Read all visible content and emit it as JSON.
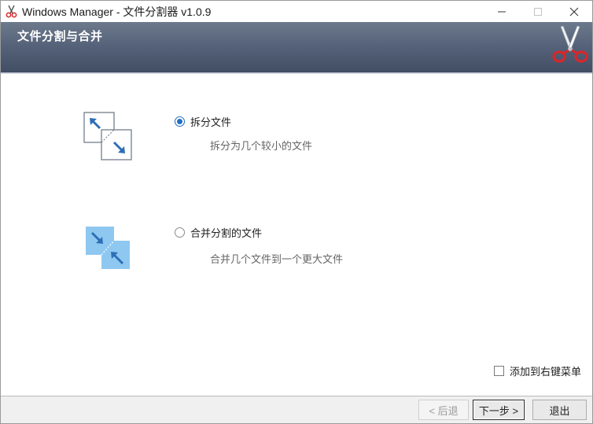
{
  "window": {
    "title": "Windows Manager - 文件分割器 v1.0.9"
  },
  "header": {
    "title": "文件分割与合并",
    "icon": "scissors-icon"
  },
  "options": [
    {
      "label": "拆分文件",
      "description": "拆分为几个较小的文件",
      "selected": true,
      "icon": "split-file-icon"
    },
    {
      "label": "合并分割的文件",
      "description": "合并几个文件到一个更大文件",
      "selected": false,
      "icon": "merge-file-icon"
    }
  ],
  "context_menu_checkbox": {
    "label": "添加到右键菜单",
    "checked": false
  },
  "buttons": {
    "back": "< 后退",
    "next": "下一步 >",
    "exit": "退出"
  },
  "colors": {
    "accent": "#1f6fc2",
    "header_top": "#6d7a8c",
    "header_bottom": "#414e63",
    "scissors_handle": "#d9262b"
  }
}
